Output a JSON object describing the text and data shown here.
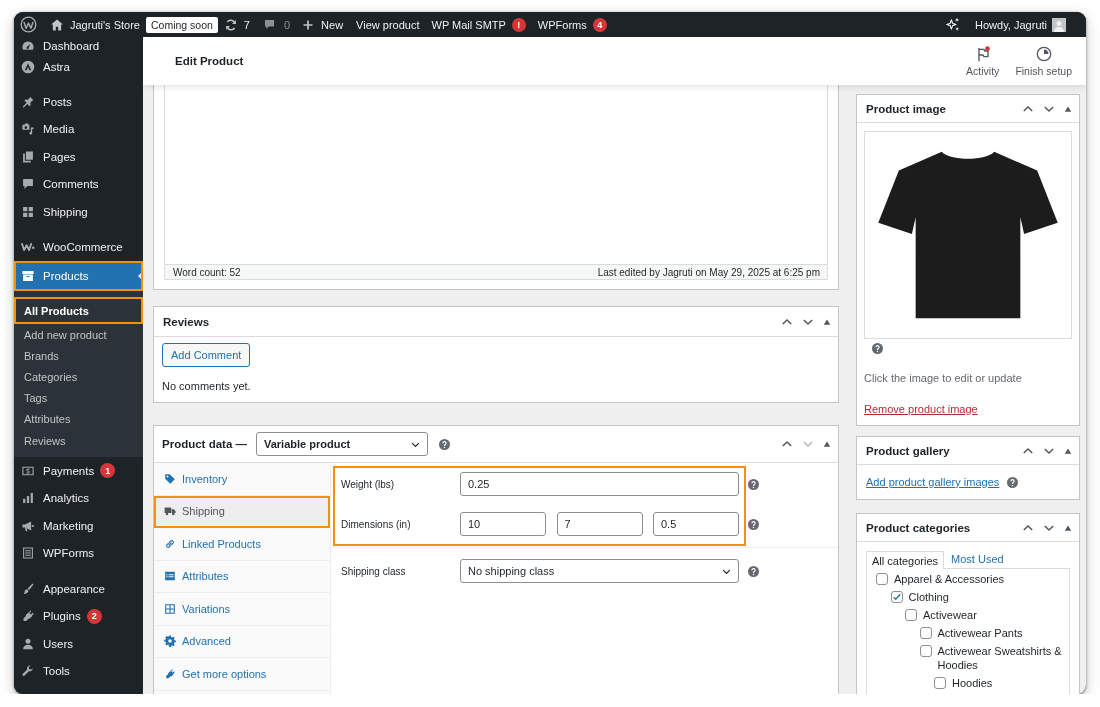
{
  "admin_bar": {
    "site_name": "Jagruti's Store",
    "site_status": "Coming soon",
    "updates_count": "7",
    "comments_count": "0",
    "new_label": "New",
    "links": [
      {
        "label": "View product"
      },
      {
        "label": "WP Mail SMTP",
        "badge": "!"
      },
      {
        "label": "WPForms",
        "badge": "4"
      }
    ],
    "greeting": "Howdy, Jagruti"
  },
  "header": {
    "title": "Edit Product",
    "actions": [
      {
        "label": "Activity",
        "notification": true
      },
      {
        "label": "Finish setup",
        "notification": false
      }
    ]
  },
  "sidebar": {
    "groups": [
      {
        "items": [
          {
            "label": "Dashboard",
            "selected": false,
            "highlighted": false
          },
          {
            "label": "Astra",
            "selected": false,
            "highlighted": false
          }
        ]
      },
      {
        "items": [
          {
            "label": "Posts",
            "selected": false,
            "highlighted": false
          },
          {
            "label": "Media",
            "selected": false,
            "highlighted": false
          },
          {
            "label": "Pages",
            "selected": false,
            "highlighted": false
          },
          {
            "label": "Comments",
            "selected": false,
            "highlighted": false
          },
          {
            "label": "Shipping",
            "selected": false,
            "highlighted": false
          }
        ]
      },
      {
        "items": [
          {
            "label": "WooCommerce",
            "selected": false,
            "highlighted": false
          },
          {
            "label": "Products",
            "selected": true,
            "highlighted": true,
            "submenu": [
              {
                "label": "All Products",
                "selected": true,
                "highlighted": true
              },
              {
                "label": "Add new product",
                "selected": false,
                "highlighted": false
              },
              {
                "label": "Brands",
                "selected": false,
                "highlighted": false
              },
              {
                "label": "Categories",
                "selected": false,
                "highlighted": false
              },
              {
                "label": "Tags",
                "selected": false,
                "highlighted": false
              },
              {
                "label": "Attributes",
                "selected": false,
                "highlighted": false
              },
              {
                "label": "Reviews",
                "selected": false,
                "highlighted": false
              }
            ]
          },
          {
            "label": "Payments",
            "badge": "1",
            "selected": false,
            "highlighted": false
          },
          {
            "label": "Analytics",
            "selected": false,
            "highlighted": false
          },
          {
            "label": "Marketing",
            "selected": false,
            "highlighted": false
          },
          {
            "label": "WPForms",
            "selected": false,
            "highlighted": false
          }
        ]
      },
      {
        "items": [
          {
            "label": "Appearance",
            "selected": false,
            "highlighted": false
          },
          {
            "label": "Plugins",
            "badge": "2",
            "selected": false,
            "highlighted": false
          },
          {
            "label": "Users",
            "selected": false,
            "highlighted": false
          },
          {
            "label": "Tools",
            "selected": false,
            "highlighted": false
          }
        ]
      }
    ]
  },
  "editor": {
    "word_count": "Word count: 52",
    "last_edited": "Last edited by Jagruti on May 29, 2025 at 6:25 pm"
  },
  "reviews": {
    "title": "Reviews",
    "move_down_disabled": false,
    "button": "Add Comment",
    "empty_text": "No comments yet."
  },
  "product_data": {
    "title": "Product data —",
    "product_type": "Variable product",
    "move_down_disabled": true,
    "tabs": [
      {
        "label": "Inventory",
        "selected": false,
        "highlighted": false
      },
      {
        "label": "Shipping",
        "selected": true,
        "highlighted": true
      },
      {
        "label": "Linked Products",
        "selected": false,
        "highlighted": false
      },
      {
        "label": "Attributes",
        "selected": false,
        "highlighted": false
      },
      {
        "label": "Variations",
        "selected": false,
        "highlighted": false
      },
      {
        "label": "Advanced",
        "selected": false,
        "highlighted": false
      },
      {
        "label": "Get more options",
        "selected": false,
        "highlighted": false
      }
    ],
    "fields_highlighted": true,
    "weight": {
      "label": "Weight (lbs)",
      "value": "0.25"
    },
    "dimensions": {
      "label": "Dimensions (in)",
      "values": [
        "10",
        "7",
        "0.5"
      ]
    },
    "shipping_class": {
      "label": "Shipping class",
      "value": "No shipping class"
    }
  },
  "product_image": {
    "title": "Product image",
    "move_down_disabled": false,
    "hint": "Click the image to edit or update",
    "remove_link": "Remove product image"
  },
  "product_gallery": {
    "title": "Product gallery",
    "move_down_disabled": false,
    "add_link": "Add product gallery images"
  },
  "product_categories": {
    "title": "Product categories",
    "move_down_disabled": false,
    "tabs": [
      {
        "label": "All categories",
        "selected": true
      },
      {
        "label": "Most Used",
        "selected": false
      }
    ],
    "categories": [
      {
        "label": "Apparel & Accessories",
        "checked": false,
        "children": [
          {
            "label": "Clothing",
            "checked": true,
            "children": [
              {
                "label": "Activewear",
                "checked": false,
                "children": [
                  {
                    "label": "Activewear Pants",
                    "checked": false
                  },
                  {
                    "label": "Activewear Sweatshirts & Hoodies",
                    "checked": false,
                    "children": [
                      {
                        "label": "Hoodies",
                        "checked": false
                      }
                    ]
                  }
                ]
              }
            ]
          }
        ]
      }
    ]
  }
}
